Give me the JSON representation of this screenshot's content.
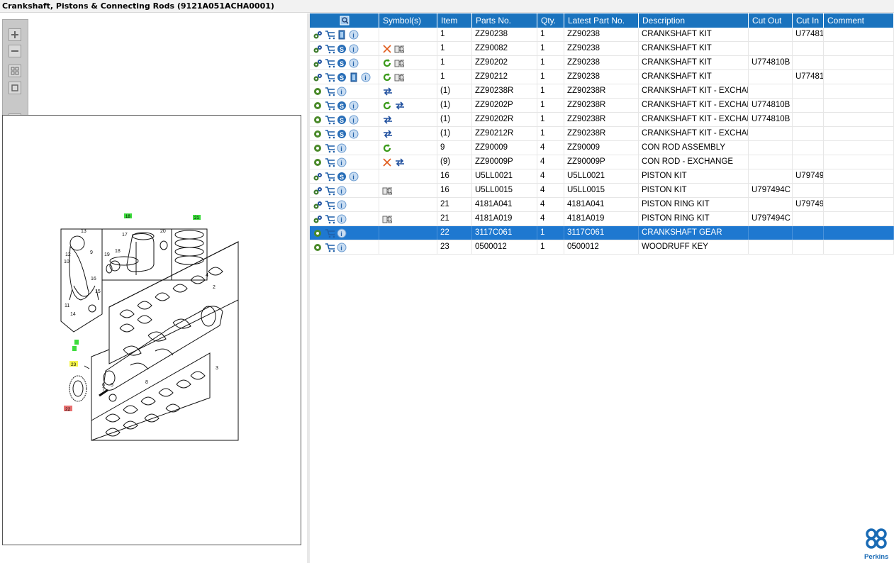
{
  "window": {
    "title": "Crankshaft, Pistons & Connecting Rods (9121A051ACHA0001)"
  },
  "toolbar": {
    "zoom_in": "zoom-in-icon",
    "zoom_out": "zoom-out-icon",
    "fit": "fit-icon",
    "actual_size": "actual-size-icon",
    "layout": "layout-toggle-icon"
  },
  "diagram": {
    "callouts": [
      "18",
      "21",
      "17",
      "20",
      "13",
      "12",
      "10",
      "9",
      "19",
      "16",
      "15",
      "11",
      "14",
      "4",
      "2",
      "8",
      "1",
      "23",
      "7",
      "6",
      "5",
      "3",
      "22"
    ]
  },
  "table": {
    "columns": [
      "",
      "Symbol(s)",
      "Item",
      "Parts No.",
      "Qty.",
      "Latest Part No.",
      "Description",
      "Cut Out",
      "Cut In",
      "Comment"
    ],
    "rows": [
      {
        "actions": [
          "settings",
          "cart",
          "doc",
          "info"
        ],
        "symbols": [],
        "item": "1",
        "part_no": "ZZ90238",
        "qty": "1",
        "latest": "ZZ90238",
        "desc": "CRANKSHAFT KIT",
        "cut_out": "",
        "cut_in": "U77481",
        "comment": "",
        "selected": false
      },
      {
        "actions": [
          "settings",
          "cart",
          "s",
          "info"
        ],
        "symbols": [
          "x",
          "book"
        ],
        "item": "1",
        "part_no": "ZZ90082",
        "qty": "1",
        "latest": "ZZ90238",
        "desc": "CRANKSHAFT KIT",
        "cut_out": "",
        "cut_in": "",
        "comment": "",
        "selected": false
      },
      {
        "actions": [
          "settings",
          "cart",
          "s",
          "info"
        ],
        "symbols": [
          "refresh",
          "book"
        ],
        "item": "1",
        "part_no": "ZZ90202",
        "qty": "1",
        "latest": "ZZ90238",
        "desc": "CRANKSHAFT KIT",
        "cut_out": "U774810B",
        "cut_in": "",
        "comment": "",
        "selected": false
      },
      {
        "actions": [
          "settings",
          "cart",
          "s",
          "doc",
          "info"
        ],
        "symbols": [
          "refresh",
          "book"
        ],
        "item": "1",
        "part_no": "ZZ90212",
        "qty": "1",
        "latest": "ZZ90238",
        "desc": "CRANKSHAFT KIT",
        "cut_out": "",
        "cut_in": "U77481",
        "comment": "",
        "selected": false
      },
      {
        "actions": [
          "gear",
          "cart",
          "info"
        ],
        "symbols": [
          "exchange"
        ],
        "item": "(1)",
        "part_no": "ZZ90238R",
        "qty": "1",
        "latest": "ZZ90238R",
        "desc": "CRANKSHAFT KIT - EXCHANGE",
        "cut_out": "",
        "cut_in": "",
        "comment": "",
        "selected": false
      },
      {
        "actions": [
          "gear",
          "cart",
          "s",
          "info"
        ],
        "symbols": [
          "refresh",
          "exchange"
        ],
        "item": "(1)",
        "part_no": "ZZ90202P",
        "qty": "1",
        "latest": "ZZ90238R",
        "desc": "CRANKSHAFT KIT - EXCHANGE",
        "cut_out": "U774810B",
        "cut_in": "",
        "comment": "",
        "selected": false
      },
      {
        "actions": [
          "gear",
          "cart",
          "s",
          "info"
        ],
        "symbols": [
          "exchange"
        ],
        "item": "(1)",
        "part_no": "ZZ90202R",
        "qty": "1",
        "latest": "ZZ90238R",
        "desc": "CRANKSHAFT KIT - EXCHANGE",
        "cut_out": "U774810B",
        "cut_in": "",
        "comment": "",
        "selected": false
      },
      {
        "actions": [
          "gear",
          "cart",
          "s",
          "info"
        ],
        "symbols": [
          "exchange"
        ],
        "item": "(1)",
        "part_no": "ZZ90212R",
        "qty": "1",
        "latest": "ZZ90238R",
        "desc": "CRANKSHAFT KIT - EXCHANGE",
        "cut_out": "",
        "cut_in": "",
        "comment": "",
        "selected": false
      },
      {
        "actions": [
          "gear",
          "cart",
          "info"
        ],
        "symbols": [
          "refresh"
        ],
        "item": "9",
        "part_no": "ZZ90009",
        "qty": "4",
        "latest": "ZZ90009",
        "desc": "CON ROD ASSEMBLY",
        "cut_out": "",
        "cut_in": "",
        "comment": "",
        "selected": false
      },
      {
        "actions": [
          "gear",
          "cart",
          "info"
        ],
        "symbols": [
          "x",
          "exchange"
        ],
        "item": "(9)",
        "part_no": "ZZ90009P",
        "qty": "4",
        "latest": "ZZ90009P",
        "desc": "CON ROD - EXCHANGE",
        "cut_out": "",
        "cut_in": "",
        "comment": "",
        "selected": false
      },
      {
        "actions": [
          "settings",
          "cart",
          "s",
          "info"
        ],
        "symbols": [],
        "item": "16",
        "part_no": "U5LL0021",
        "qty": "4",
        "latest": "U5LL0021",
        "desc": "PISTON KIT",
        "cut_out": "",
        "cut_in": "U79749",
        "comment": "",
        "selected": false
      },
      {
        "actions": [
          "settings",
          "cart",
          "info"
        ],
        "symbols": [
          "book"
        ],
        "item": "16",
        "part_no": "U5LL0015",
        "qty": "4",
        "latest": "U5LL0015",
        "desc": "PISTON KIT",
        "cut_out": "U797494C",
        "cut_in": "",
        "comment": "",
        "selected": false
      },
      {
        "actions": [
          "settings",
          "cart",
          "info"
        ],
        "symbols": [],
        "item": "21",
        "part_no": "4181A041",
        "qty": "4",
        "latest": "4181A041",
        "desc": "PISTON RING KIT",
        "cut_out": "",
        "cut_in": "U79749",
        "comment": "",
        "selected": false
      },
      {
        "actions": [
          "settings",
          "cart",
          "info"
        ],
        "symbols": [
          "book"
        ],
        "item": "21",
        "part_no": "4181A019",
        "qty": "4",
        "latest": "4181A019",
        "desc": "PISTON RING KIT",
        "cut_out": "U797494C",
        "cut_in": "",
        "comment": "",
        "selected": false
      },
      {
        "actions": [
          "gear",
          "cart",
          "info"
        ],
        "symbols": [],
        "item": "22",
        "part_no": "3117C061",
        "qty": "1",
        "latest": "3117C061",
        "desc": "CRANKSHAFT GEAR",
        "cut_out": "",
        "cut_in": "",
        "comment": "",
        "selected": true
      },
      {
        "actions": [
          "gear",
          "cart",
          "info"
        ],
        "symbols": [],
        "item": "23",
        "part_no": "0500012",
        "qty": "1",
        "latest": "0500012",
        "desc": "WOODRUFF KEY",
        "cut_out": "",
        "cut_in": "",
        "comment": "",
        "selected": false
      }
    ]
  },
  "brand": {
    "name": "Perkins",
    "color": "#1a6bb5"
  },
  "colors": {
    "header": "#1a73be",
    "selected": "#1e78d0",
    "callout_green": "#3ddc3d",
    "callout_yellow": "#f5f54a",
    "callout_red": "#e87070"
  }
}
